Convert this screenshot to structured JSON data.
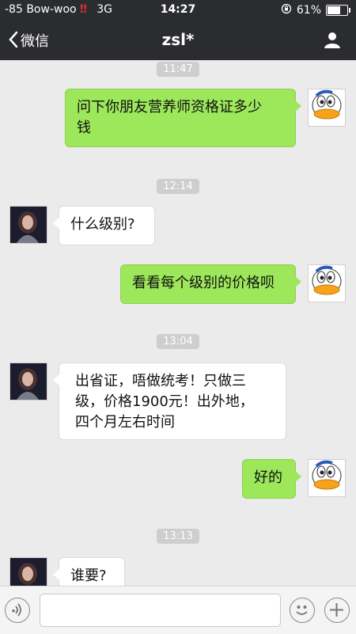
{
  "status_bar": {
    "signal": "-85 Bow-woo",
    "alert_icon": "double-exclamation-icon",
    "network": "3G",
    "time": "14:27",
    "battery": "61%",
    "battery_level": 0.61
  },
  "nav": {
    "back_label": "微信",
    "title": "zsl*",
    "profile_icon": "person-icon"
  },
  "messages": [
    {
      "type": "timestamp",
      "text": "11:47"
    },
    {
      "type": "sent",
      "lines": [
        "问下你朋友营养师资格证多少",
        "钱"
      ]
    },
    {
      "type": "timestamp",
      "text": "12:14"
    },
    {
      "type": "received",
      "lines": [
        "什么级别?"
      ]
    },
    {
      "type": "sent",
      "lines": [
        "看看每个级别的价格呗"
      ]
    },
    {
      "type": "timestamp",
      "text": "13:04"
    },
    {
      "type": "received",
      "lines": [
        "出省证，唔做统考！只做三",
        "级，价格1900元！出外地，",
        "四个月左右时间"
      ]
    },
    {
      "type": "sent",
      "lines": [
        "好的"
      ]
    },
    {
      "type": "timestamp",
      "text": "13:13"
    },
    {
      "type": "received",
      "lines": [
        "谁要?"
      ]
    }
  ],
  "input_bar": {
    "voice_icon": "voice-icon",
    "text_value": "",
    "emoji_icon": "emoji-icon",
    "plus_icon": "plus-icon"
  },
  "colors": {
    "nav_bg": "#2b2c30",
    "sent_bubble": "#9de75b",
    "received_bubble": "#ffffff",
    "chat_bg": "#ebebeb"
  }
}
